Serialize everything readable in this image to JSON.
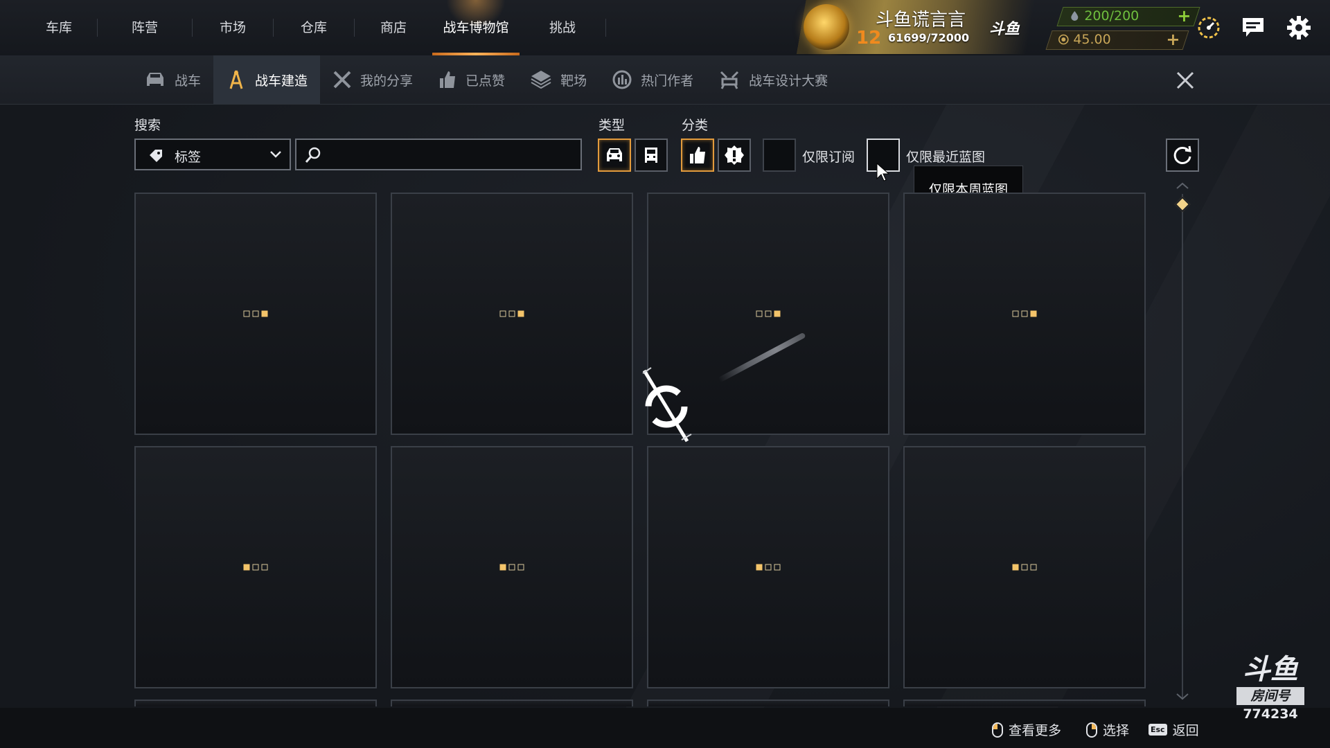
{
  "top_nav": {
    "tabs": [
      {
        "label": "车库"
      },
      {
        "label": "阵营"
      },
      {
        "label": "市场"
      },
      {
        "label": "仓库"
      },
      {
        "label": "商店"
      },
      {
        "label": "战车博物馆"
      },
      {
        "label": "挑战"
      }
    ],
    "active_tab": "战车博物馆"
  },
  "player": {
    "name": "斗鱼谎言言",
    "level": "12",
    "xp": "61699/72000",
    "brand": "斗鱼"
  },
  "resources": {
    "fuel": "200/200",
    "coins": "45.00"
  },
  "top_icons": [
    "speedometer-icon",
    "chat-icon",
    "settings-gear-icon"
  ],
  "sub_nav": {
    "tabs": [
      {
        "label": "战车",
        "icon": "car-icon"
      },
      {
        "label": "战车建造",
        "icon": "compass-icon"
      },
      {
        "label": "我的分享",
        "icon": "tools-icon"
      },
      {
        "label": "已点赞",
        "icon": "thumbs-up-icon"
      },
      {
        "label": "靶场",
        "icon": "target-range-icon"
      },
      {
        "label": "热门作者",
        "icon": "popular-author-icon"
      },
      {
        "label": "战车设计大赛",
        "icon": "design-contest-icon"
      }
    ],
    "active_tab": "战车建造"
  },
  "filters": {
    "search_label": "搜索",
    "tag_select_value": "标签",
    "search_placeholder": "",
    "type_label": "类型",
    "category_label": "分类",
    "subscribed_only": "仅限订阅",
    "recent_only": "仅限最近蓝图",
    "tooltip": "仅限本周蓝图"
  },
  "loading_cards": [
    {
      "lit": 2
    },
    {
      "lit": 2
    },
    {
      "lit": 2
    },
    {
      "lit": 2
    },
    {
      "lit": 0
    },
    {
      "lit": 0
    },
    {
      "lit": 0
    },
    {
      "lit": 0
    }
  ],
  "bottom": {
    "hints": [
      {
        "label": "查看更多",
        "input": "mouse-left"
      },
      {
        "label": "选择",
        "input": "mouse-right"
      },
      {
        "label": "返回",
        "input": "Esc"
      }
    ]
  },
  "watermark": {
    "logo": "斗鱼",
    "room_label": "房间号",
    "room_number": "774234"
  },
  "colors": {
    "accent_orange": "#e39b3c",
    "loading_dot": "#f3c46a",
    "fuel_green": "#6fbf3e"
  }
}
